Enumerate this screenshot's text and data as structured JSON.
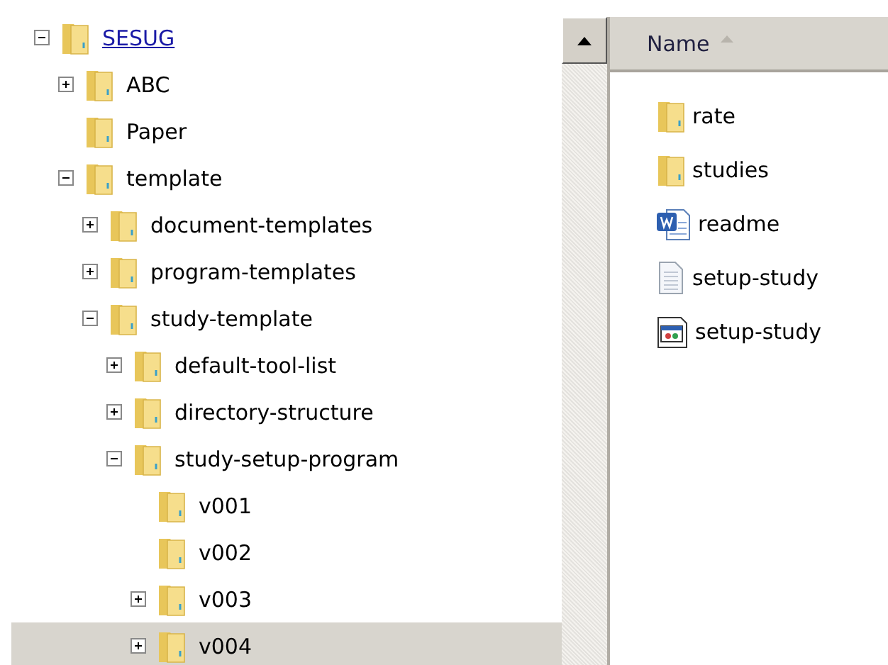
{
  "tree": [
    {
      "label": "SESUG",
      "expanded": true,
      "selected": false,
      "hovered": true,
      "children": [
        {
          "label": "ABC",
          "expanded": false,
          "selected": false,
          "hovered": false
        },
        {
          "label": "Paper",
          "selected": false,
          "hovered": false
        },
        {
          "label": "template",
          "expanded": true,
          "selected": false,
          "hovered": false,
          "children": [
            {
              "label": "document-templates",
              "expanded": false,
              "selected": false,
              "hovered": false
            },
            {
              "label": "program-templates",
              "expanded": false,
              "selected": false,
              "hovered": false
            },
            {
              "label": "study-template",
              "expanded": true,
              "selected": false,
              "hovered": false,
              "children": [
                {
                  "label": "default-tool-list",
                  "expanded": false,
                  "selected": false,
                  "hovered": false
                },
                {
                  "label": "directory-structure",
                  "expanded": false,
                  "selected": false,
                  "hovered": false
                },
                {
                  "label": "study-setup-program",
                  "expanded": true,
                  "selected": false,
                  "hovered": false,
                  "children": [
                    {
                      "label": "v001",
                      "selected": false,
                      "hovered": false
                    },
                    {
                      "label": "v002",
                      "selected": false,
                      "hovered": false
                    },
                    {
                      "label": "v003",
                      "expanded": false,
                      "selected": false,
                      "hovered": false
                    },
                    {
                      "label": "v004",
                      "expanded": false,
                      "selected": true,
                      "hovered": false
                    }
                  ]
                }
              ]
            }
          ]
        }
      ]
    }
  ],
  "list": {
    "column": "Name",
    "files": [
      {
        "name": "rate",
        "kind": "folder"
      },
      {
        "name": "studies",
        "kind": "folder"
      },
      {
        "name": "readme",
        "kind": "word"
      },
      {
        "name": "setup-study",
        "kind": "text"
      },
      {
        "name": "setup-study",
        "kind": "app"
      }
    ]
  }
}
